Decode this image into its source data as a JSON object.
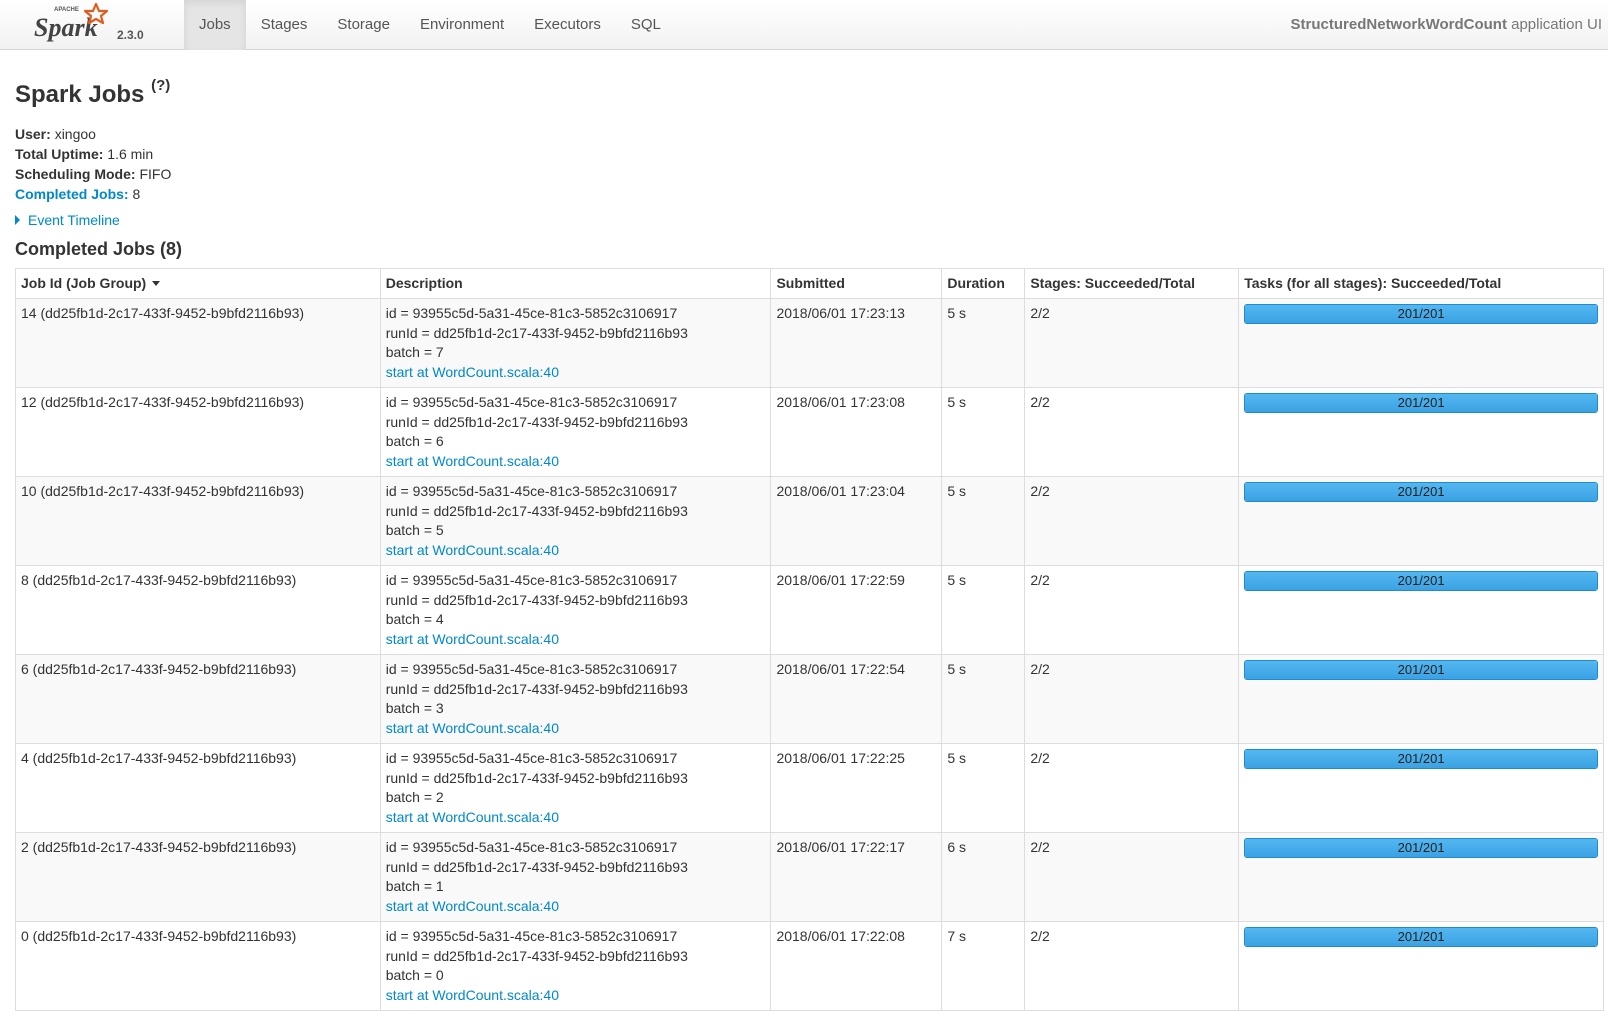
{
  "brand": {
    "logo_text": "Spark",
    "logo_sub": "APACHE",
    "version": "2.3.0"
  },
  "nav": {
    "items": [
      {
        "label": "Jobs",
        "active": true
      },
      {
        "label": "Stages",
        "active": false
      },
      {
        "label": "Storage",
        "active": false
      },
      {
        "label": "Environment",
        "active": false
      },
      {
        "label": "Executors",
        "active": false
      },
      {
        "label": "SQL",
        "active": false
      }
    ],
    "app_name": "StructuredNetworkWordCount",
    "app_suffix": " application UI"
  },
  "page": {
    "title": "Spark Jobs",
    "help": "?",
    "summary": {
      "user_label": "User:",
      "user": "xingoo",
      "uptime_label": "Total Uptime:",
      "uptime": "1.6 min",
      "mode_label": "Scheduling Mode:",
      "mode": "FIFO",
      "completed_label": "Completed Jobs:",
      "completed": "8"
    },
    "event_timeline": "Event Timeline",
    "section_title": "Completed Jobs (8)"
  },
  "table": {
    "headers": {
      "job_id": "Job Id (Job Group)",
      "description": "Description",
      "submitted": "Submitted",
      "duration": "Duration",
      "stages": "Stages: Succeeded/Total",
      "tasks": "Tasks (for all stages): Succeeded/Total"
    },
    "rows": [
      {
        "job": "14 (dd25fb1d-2c17-433f-9452-b9bfd2116b93)",
        "d1": "id = 93955c5d-5a31-45ce-81c3-5852c3106917",
        "d2": "runId = dd25fb1d-2c17-433f-9452-b9bfd2116b93",
        "d3": "batch = 7",
        "link": "start at WordCount.scala:40",
        "submitted": "2018/06/01 17:23:13",
        "duration": "5 s",
        "stages": "2/2",
        "tasks": "201/201",
        "progress": 1.0
      },
      {
        "job": "12 (dd25fb1d-2c17-433f-9452-b9bfd2116b93)",
        "d1": "id = 93955c5d-5a31-45ce-81c3-5852c3106917",
        "d2": "runId = dd25fb1d-2c17-433f-9452-b9bfd2116b93",
        "d3": "batch = 6",
        "link": "start at WordCount.scala:40",
        "submitted": "2018/06/01 17:23:08",
        "duration": "5 s",
        "stages": "2/2",
        "tasks": "201/201",
        "progress": 1.0
      },
      {
        "job": "10 (dd25fb1d-2c17-433f-9452-b9bfd2116b93)",
        "d1": "id = 93955c5d-5a31-45ce-81c3-5852c3106917",
        "d2": "runId = dd25fb1d-2c17-433f-9452-b9bfd2116b93",
        "d3": "batch = 5",
        "link": "start at WordCount.scala:40",
        "submitted": "2018/06/01 17:23:04",
        "duration": "5 s",
        "stages": "2/2",
        "tasks": "201/201",
        "progress": 1.0
      },
      {
        "job": "8 (dd25fb1d-2c17-433f-9452-b9bfd2116b93)",
        "d1": "id = 93955c5d-5a31-45ce-81c3-5852c3106917",
        "d2": "runId = dd25fb1d-2c17-433f-9452-b9bfd2116b93",
        "d3": "batch = 4",
        "link": "start at WordCount.scala:40",
        "submitted": "2018/06/01 17:22:59",
        "duration": "5 s",
        "stages": "2/2",
        "tasks": "201/201",
        "progress": 1.0
      },
      {
        "job": "6 (dd25fb1d-2c17-433f-9452-b9bfd2116b93)",
        "d1": "id = 93955c5d-5a31-45ce-81c3-5852c3106917",
        "d2": "runId = dd25fb1d-2c17-433f-9452-b9bfd2116b93",
        "d3": "batch = 3",
        "link": "start at WordCount.scala:40",
        "submitted": "2018/06/01 17:22:54",
        "duration": "5 s",
        "stages": "2/2",
        "tasks": "201/201",
        "progress": 1.0
      },
      {
        "job": "4 (dd25fb1d-2c17-433f-9452-b9bfd2116b93)",
        "d1": "id = 93955c5d-5a31-45ce-81c3-5852c3106917",
        "d2": "runId = dd25fb1d-2c17-433f-9452-b9bfd2116b93",
        "d3": "batch = 2",
        "link": "start at WordCount.scala:40",
        "submitted": "2018/06/01 17:22:25",
        "duration": "5 s",
        "stages": "2/2",
        "tasks": "201/201",
        "progress": 1.0
      },
      {
        "job": "2 (dd25fb1d-2c17-433f-9452-b9bfd2116b93)",
        "d1": "id = 93955c5d-5a31-45ce-81c3-5852c3106917",
        "d2": "runId = dd25fb1d-2c17-433f-9452-b9bfd2116b93",
        "d3": "batch = 1",
        "link": "start at WordCount.scala:40",
        "submitted": "2018/06/01 17:22:17",
        "duration": "6 s",
        "stages": "2/2",
        "tasks": "201/201",
        "progress": 1.0
      },
      {
        "job": "0 (dd25fb1d-2c17-433f-9452-b9bfd2116b93)",
        "d1": "id = 93955c5d-5a31-45ce-81c3-5852c3106917",
        "d2": "runId = dd25fb1d-2c17-433f-9452-b9bfd2116b93",
        "d3": "batch = 0",
        "link": "start at WordCount.scala:40",
        "submitted": "2018/06/01 17:22:08",
        "duration": "7 s",
        "stages": "2/2",
        "tasks": "201/201",
        "progress": 1.0
      }
    ]
  },
  "colors": {
    "link": "#0088cc",
    "progress_fill": "#3ba2e3",
    "brand_orange": "#e25a1c"
  }
}
